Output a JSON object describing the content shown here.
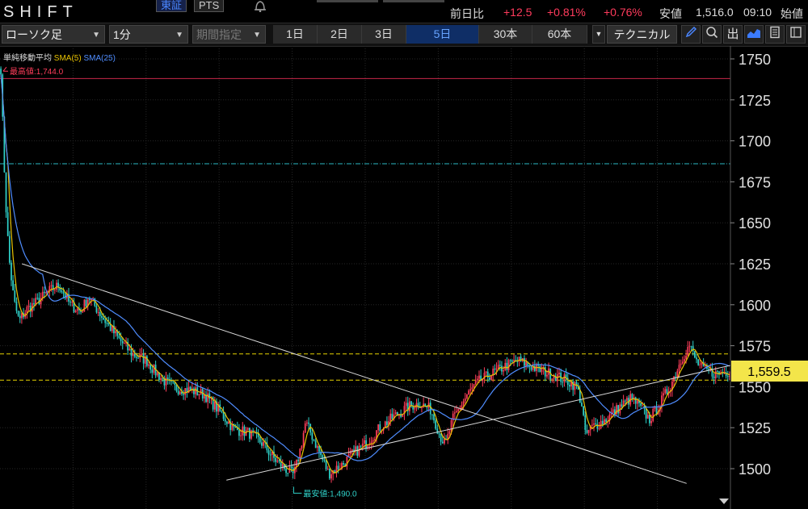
{
  "header": {
    "symbol": "SHIFT",
    "exchange_primary": "東証",
    "exchange_secondary": "PTS",
    "change_label": "前日比",
    "change_value": "+12.5",
    "change_pct": "+0.81%",
    "change_pct2": "+0.76%",
    "quote_label": "安値",
    "quote_value": "1,516.0",
    "quote_time": "09:10",
    "next_label": "始値"
  },
  "toolbar": {
    "chart_type": "ローソク足",
    "interval": "1分",
    "period_select": "期間指定",
    "periods": [
      "1日",
      "2日",
      "3日",
      "5日",
      "30本",
      "60本"
    ],
    "active_period": "5日",
    "technical": "テクニカル",
    "icons": [
      "pencil-icon",
      "zoom-icon",
      "output-icon",
      "area-chart-icon",
      "document-icon",
      "layout-icon"
    ],
    "accent_color": "#4a86ff"
  },
  "legend": {
    "title": "単純移動平均",
    "sma5": "SMA(5)",
    "sma25": "SMA(25)",
    "sma5_color": "#e8c200",
    "sma25_color": "#4f8dff"
  },
  "chart_data": {
    "type": "candlestick",
    "ylim": [
      1485,
      1760
    ],
    "y_ticks": [
      1750,
      1725,
      1700,
      1675,
      1650,
      1625,
      1600,
      1575,
      1550,
      1525,
      1500
    ],
    "current_price": "1,559.5",
    "current_price_value": 1559.5,
    "high_label": "最高値:1,744.0",
    "high_value": 1744.0,
    "low_label": "最安値:1,490.0",
    "low_value": 1490.0,
    "horizontal_lines": [
      {
        "value": 1738,
        "style": "solid",
        "color": "#c8284a"
      },
      {
        "value": 1686,
        "style": "dash-dot",
        "color": "#2bb7c4"
      },
      {
        "value": 1570,
        "style": "dashed",
        "color": "#e6d200"
      },
      {
        "value": 1554,
        "style": "dashed",
        "color": "#e6d200"
      }
    ],
    "trendlines": [
      {
        "from": [
          0.03,
          1625
        ],
        "to": [
          0.94,
          1491
        ]
      },
      {
        "from": [
          0.31,
          1493
        ],
        "to": [
          1.0,
          1563
        ]
      }
    ],
    "price_path": [
      [
        0.0,
        1744
      ],
      [
        0.004,
        1690
      ],
      [
        0.008,
        1650
      ],
      [
        0.012,
        1625
      ],
      [
        0.018,
        1602
      ],
      [
        0.025,
        1590
      ],
      [
        0.035,
        1597
      ],
      [
        0.05,
        1602
      ],
      [
        0.065,
        1608
      ],
      [
        0.08,
        1612
      ],
      [
        0.095,
        1600
      ],
      [
        0.11,
        1596
      ],
      [
        0.12,
        1605
      ],
      [
        0.14,
        1592
      ],
      [
        0.16,
        1580
      ],
      [
        0.18,
        1570
      ],
      [
        0.2,
        1566
      ],
      [
        0.21,
        1560
      ],
      [
        0.225,
        1553
      ],
      [
        0.24,
        1549
      ],
      [
        0.26,
        1548
      ],
      [
        0.28,
        1545
      ],
      [
        0.3,
        1535
      ],
      [
        0.32,
        1524
      ],
      [
        0.34,
        1522
      ],
      [
        0.36,
        1515
      ],
      [
        0.375,
        1506
      ],
      [
        0.39,
        1500
      ],
      [
        0.402,
        1496
      ],
      [
        0.41,
        1510
      ],
      [
        0.418,
        1528
      ],
      [
        0.425,
        1522
      ],
      [
        0.435,
        1512
      ],
      [
        0.45,
        1497
      ],
      [
        0.46,
        1500
      ],
      [
        0.47,
        1503
      ],
      [
        0.48,
        1508
      ],
      [
        0.5,
        1515
      ],
      [
        0.52,
        1525
      ],
      [
        0.54,
        1532
      ],
      [
        0.56,
        1538
      ],
      [
        0.575,
        1540
      ],
      [
        0.59,
        1536
      ],
      [
        0.603,
        1520
      ],
      [
        0.61,
        1514
      ],
      [
        0.62,
        1530
      ],
      [
        0.64,
        1545
      ],
      [
        0.655,
        1553
      ],
      [
        0.67,
        1557
      ],
      [
        0.69,
        1562
      ],
      [
        0.71,
        1566
      ],
      [
        0.725,
        1563
      ],
      [
        0.74,
        1560
      ],
      [
        0.76,
        1557
      ],
      [
        0.78,
        1553
      ],
      [
        0.79,
        1550
      ],
      [
        0.798,
        1538
      ],
      [
        0.802,
        1520
      ],
      [
        0.81,
        1525
      ],
      [
        0.83,
        1530
      ],
      [
        0.85,
        1538
      ],
      [
        0.865,
        1543
      ],
      [
        0.88,
        1536
      ],
      [
        0.89,
        1530
      ],
      [
        0.905,
        1540
      ],
      [
        0.92,
        1552
      ],
      [
        0.935,
        1568
      ],
      [
        0.945,
        1575
      ],
      [
        0.955,
        1565
      ],
      [
        0.965,
        1560
      ],
      [
        0.98,
        1558
      ],
      [
        1.0,
        1559.5
      ]
    ]
  }
}
